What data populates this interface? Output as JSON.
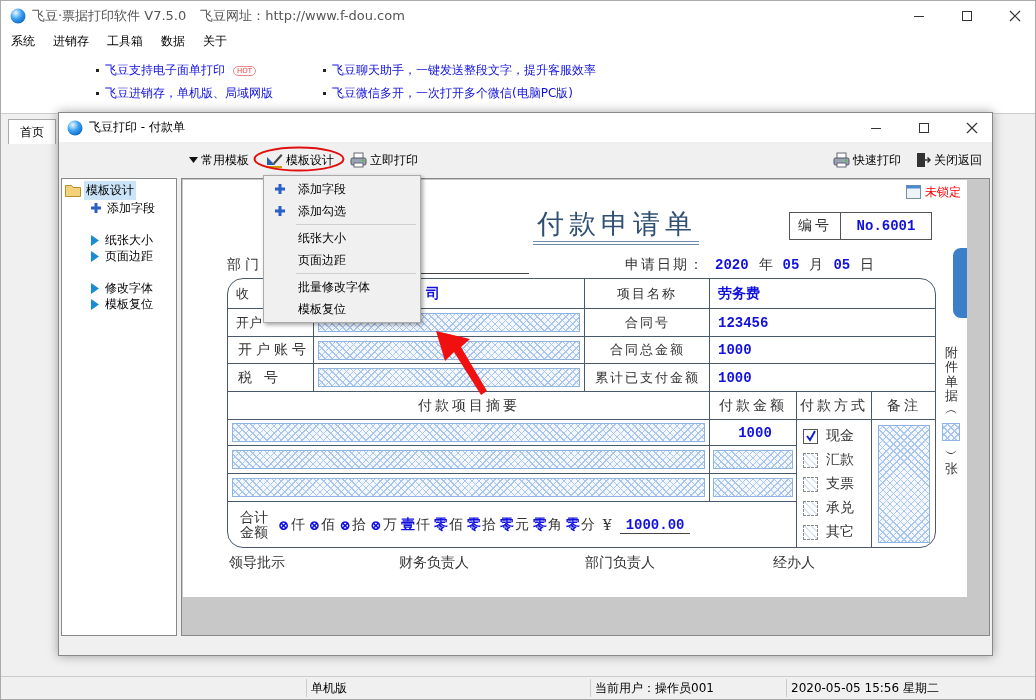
{
  "app": {
    "title": "飞豆·票据打印软件 V7.5.0",
    "site": "飞豆网址：http://www.f-dou.com"
  },
  "menu": [
    "系统",
    "进销存",
    "工具箱",
    "数据",
    "关于"
  ],
  "news": [
    {
      "text": "飞豆支持电子面单打印",
      "badge": "HOT"
    },
    {
      "text": "飞豆聊天助手，一键发送整段文字，提升客服效率"
    },
    {
      "text": "飞豆进销存，单机版、局域网版"
    },
    {
      "text": "飞豆微信多开，一次打开多个微信(电脑PC版)"
    }
  ],
  "tabs": [
    {
      "label": "首页",
      "selected": true
    }
  ],
  "dialog": {
    "title": "飞豆打印 - 付款单",
    "toolbar_left": [
      {
        "kind": "dropdown",
        "label": "常用模板",
        "highlighted": false
      },
      {
        "kind": "design",
        "label": "模板设计",
        "highlighted": true
      },
      {
        "kind": "print",
        "label": "立即打印",
        "highlighted": false
      }
    ],
    "toolbar_right": [
      {
        "kind": "print",
        "label": "快速打印"
      },
      {
        "kind": "exit",
        "label": "关闭返回"
      }
    ],
    "tree": {
      "label": "模板设计",
      "selected": true,
      "children": [
        {
          "label": "添加字段",
          "kind": "add"
        },
        {
          "kind": "spacer"
        },
        {
          "label": "纸张大小",
          "kind": "arrow"
        },
        {
          "label": "页面边距",
          "kind": "arrow"
        },
        {
          "kind": "spacer"
        },
        {
          "label": "修改字体",
          "kind": "arrow"
        },
        {
          "label": "模板复位",
          "kind": "arrow"
        }
      ]
    },
    "dropdown_menu": [
      {
        "kind": "add",
        "label": "添加字段"
      },
      {
        "kind": "add",
        "label": "添加勾选"
      },
      {
        "kind": "separator"
      },
      {
        "kind": "plain",
        "label": "纸张大小"
      },
      {
        "kind": "plain",
        "label": "页面边距"
      },
      {
        "kind": "separator"
      },
      {
        "kind": "plain",
        "label": "批量修改字体"
      },
      {
        "kind": "plain",
        "label": "模板复位"
      }
    ],
    "lock_status": "未锁定"
  },
  "form": {
    "title": "付款申请单",
    "number_label": "编号",
    "number": "No.6001",
    "dept_label": "部门",
    "date_label": "申请日期：",
    "date": [
      {
        "value": "2020",
        "unit": "年"
      },
      {
        "value": "05",
        "unit": "月"
      },
      {
        "value": "05",
        "unit": "日"
      }
    ],
    "rows": [
      {
        "label": "收",
        "value": "司",
        "label2": "项目名称",
        "value2": "劳务费"
      },
      {
        "label": "开户",
        "label2": "合同号",
        "value2": "123456"
      },
      {
        "label": "开户账号",
        "label2": "合同总金额",
        "value2": "1000"
      },
      {
        "label": "税 号",
        "label2": "累计已支付金额",
        "value2": "1000"
      }
    ],
    "columns": [
      "付款项目摘要",
      "付款金额",
      "付款方式",
      "备注"
    ],
    "amounts": [
      {
        "kind": "text",
        "value": "1000"
      },
      {
        "kind": "field"
      },
      {
        "kind": "field"
      }
    ],
    "payment_methods": [
      {
        "label": "现金",
        "checked": true
      },
      {
        "label": "汇款",
        "checked": false
      },
      {
        "label": "支票",
        "checked": false
      },
      {
        "label": "承兑",
        "checked": false
      },
      {
        "label": "其它",
        "checked": false
      }
    ],
    "total_label": "合计金额",
    "total_digits": [
      {
        "value": "⊗",
        "unit": "仟"
      },
      {
        "value": "⊗",
        "unit": "佰"
      },
      {
        "value": "⊗",
        "unit": "拾"
      },
      {
        "value": "⊗",
        "unit": "万"
      },
      {
        "value": "壹",
        "unit": "仟"
      },
      {
        "value": "零",
        "unit": "佰"
      },
      {
        "value": "零",
        "unit": "拾"
      },
      {
        "value": "零",
        "unit": "元"
      },
      {
        "value": "零",
        "unit": "角"
      },
      {
        "value": "零",
        "unit": "分"
      }
    ],
    "currency": "¥",
    "total": "1000.00",
    "attachment_prefix": "附件单据︵",
    "attachment_suffix": "︶张",
    "signatures": [
      "领导批示",
      "财务负责人",
      "部门负责人",
      "经办人"
    ]
  },
  "status_bar": [
    "单机版",
    "当前用户：操作员001",
    "2020-05-05 15:56 星期二"
  ]
}
